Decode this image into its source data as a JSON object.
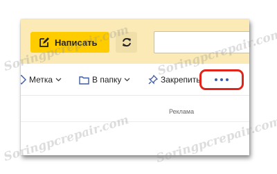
{
  "header": {
    "compose_label": "Написать",
    "compose_icon": "pencil-square-icon",
    "refresh_icon": "refresh-icon",
    "search_value": "",
    "header_bg": "#fbeab5",
    "compose_bg": "#ffcc00"
  },
  "toolbar": {
    "items": [
      {
        "label": "Метка",
        "icon": "tag-icon"
      },
      {
        "label": "В папку",
        "icon": "folder-icon"
      },
      {
        "label": "Закрепить",
        "icon": "pin-icon"
      }
    ],
    "more_icon": "more-dots-icon",
    "highlight_color": "#e2231a"
  },
  "content": {
    "ad_label": "Реклама"
  },
  "watermark": {
    "text": "Soringpcrepair.com"
  }
}
